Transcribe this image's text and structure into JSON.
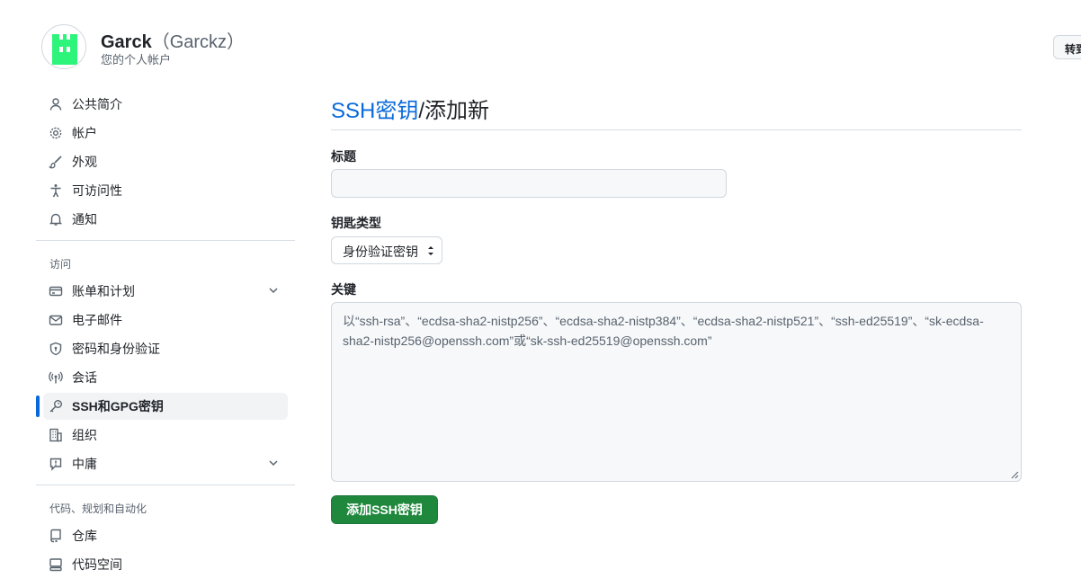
{
  "user": {
    "display_name": "Garck",
    "login": "（Garckz）",
    "subtitle": "您的个人帐户",
    "switch_button": "转到"
  },
  "sidebar": {
    "items": [
      {
        "label": "公共简介",
        "icon": "person-icon"
      },
      {
        "label": "帐户",
        "icon": "gear-icon"
      },
      {
        "label": "外观",
        "icon": "paintbrush-icon"
      },
      {
        "label": "可访问性",
        "icon": "accessibility-icon"
      },
      {
        "label": "通知",
        "icon": "bell-icon"
      }
    ],
    "access_section": {
      "label": "访问",
      "items": [
        {
          "label": "账单和计划",
          "icon": "credit-card-icon",
          "expandable": true
        },
        {
          "label": "电子邮件",
          "icon": "mail-icon"
        },
        {
          "label": "密码和身份验证",
          "icon": "shield-lock-icon"
        },
        {
          "label": "会话",
          "icon": "broadcast-icon"
        },
        {
          "label": "SSH和GPG密钥",
          "icon": "key-icon",
          "active": true
        },
        {
          "label": "组织",
          "icon": "organization-icon"
        },
        {
          "label": "中庸",
          "icon": "report-icon",
          "expandable": true
        }
      ]
    },
    "code_section": {
      "label": "代码、规划和自动化",
      "items": [
        {
          "label": "仓库",
          "icon": "repo-icon"
        },
        {
          "label": "代码空间",
          "icon": "codespaces-icon"
        }
      ]
    }
  },
  "main": {
    "breadcrumb_link": "SSH密钥",
    "breadcrumb_current": "/添加新",
    "title_label": "标题",
    "title_value": "",
    "key_type_label": "钥匙类型",
    "key_type_selected": "身份验证密钥",
    "key_label": "关键",
    "key_placeholder": "以“ssh-rsa”、“ecdsa-sha2-nistp256”、“ecdsa-sha2-nistp384”、“ecdsa-sha2-nistp521”、“ssh-ed25519”、“sk-ecdsa-sha2-nistp256@openssh.com”或“sk-ssh-ed25519@openssh.com”",
    "submit_button": "添加SSH密钥"
  },
  "colors": {
    "accent": "#0969da",
    "primary_button": "#1f883d",
    "avatar": "#2df57b"
  }
}
